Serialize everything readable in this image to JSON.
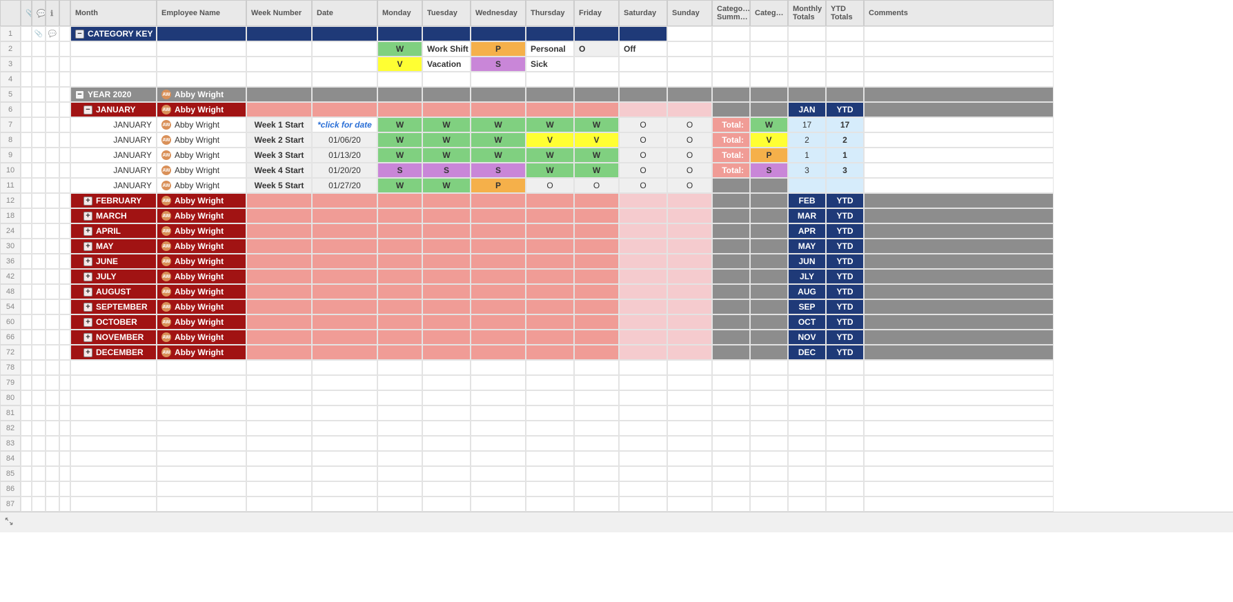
{
  "headers": [
    "",
    "",
    "",
    "",
    "",
    "Month",
    "Employee Name",
    "Week Number",
    "Date",
    "Monday",
    "Tuesday",
    "Wednesday",
    "Thursday",
    "Friday",
    "Saturday",
    "Sunday",
    "Catego… Summ…",
    "Categ…",
    "Monthly Totals",
    "YTD Totals",
    "Comments"
  ],
  "hdr_icons": {
    "1": "📎",
    "2": "💬",
    "3": "ℹ"
  },
  "employee": "Abby Wright",
  "avatar_initials": "AW",
  "cat_key_title": "CATEGORY KEY",
  "year_title": "YEAR 2020",
  "key": {
    "W": {
      "code": "W",
      "label": "Work Shift"
    },
    "P": {
      "code": "P",
      "label": "Personal"
    },
    "O": {
      "code": "O",
      "label": "Off"
    },
    "V": {
      "code": "V",
      "label": "Vacation"
    },
    "S": {
      "code": "S",
      "label": "Sick"
    }
  },
  "jan": {
    "title": "JANUARY",
    "short": "JAN",
    "ytd": "YTD"
  },
  "click_for_date": "*click for date",
  "weeks": [
    {
      "n": "1",
      "label": "Week 1 Start",
      "date": "",
      "mon": "W",
      "tue": "W",
      "wed": "W",
      "thu": "W",
      "fri": "W",
      "sat": "O",
      "sun": "O",
      "tot": "Total:",
      "cat": "W",
      "mtot": "17",
      "ytot": "17"
    },
    {
      "n": "2",
      "label": "Week 2 Start",
      "date": "01/06/20",
      "mon": "W",
      "tue": "W",
      "wed": "W",
      "thu": "V",
      "fri": "V",
      "sat": "O",
      "sun": "O",
      "tot": "Total:",
      "cat": "V",
      "mtot": "2",
      "ytot": "2"
    },
    {
      "n": "3",
      "label": "Week 3 Start",
      "date": "01/13/20",
      "mon": "W",
      "tue": "W",
      "wed": "W",
      "thu": "W",
      "fri": "W",
      "sat": "O",
      "sun": "O",
      "tot": "Total:",
      "cat": "P",
      "mtot": "1",
      "ytot": "1"
    },
    {
      "n": "4",
      "label": "Week 4 Start",
      "date": "01/20/20",
      "mon": "S",
      "tue": "S",
      "wed": "S",
      "thu": "W",
      "fri": "W",
      "sat": "O",
      "sun": "O",
      "tot": "Total:",
      "cat": "S",
      "mtot": "3",
      "ytot": "3"
    },
    {
      "n": "5",
      "label": "Week 5 Start",
      "date": "01/27/20",
      "mon": "W",
      "tue": "W",
      "wed": "P",
      "thu": "O",
      "fri": "O",
      "sat": "O",
      "sun": "O",
      "tot": "",
      "cat": "",
      "mtot": "",
      "ytot": ""
    }
  ],
  "months": [
    {
      "r": "12",
      "name": "FEBRUARY",
      "short": "FEB"
    },
    {
      "r": "18",
      "name": "MARCH",
      "short": "MAR"
    },
    {
      "r": "24",
      "name": "APRIL",
      "short": "APR"
    },
    {
      "r": "30",
      "name": "MAY",
      "short": "MAY"
    },
    {
      "r": "36",
      "name": "JUNE",
      "short": "JUN"
    },
    {
      "r": "42",
      "name": "JULY",
      "short": "JLY"
    },
    {
      "r": "48",
      "name": "AUGUST",
      "short": "AUG"
    },
    {
      "r": "54",
      "name": "SEPTEMBER",
      "short": "SEP"
    },
    {
      "r": "60",
      "name": "OCTOBER",
      "short": "OCT"
    },
    {
      "r": "66",
      "name": "NOVEMBER",
      "short": "NOV"
    },
    {
      "r": "72",
      "name": "DECEMBER",
      "short": "DEC"
    }
  ],
  "ytd": "YTD",
  "empty_rows": [
    "78",
    "79",
    "80",
    "81",
    "82",
    "83",
    "84",
    "85",
    "86",
    "87"
  ]
}
